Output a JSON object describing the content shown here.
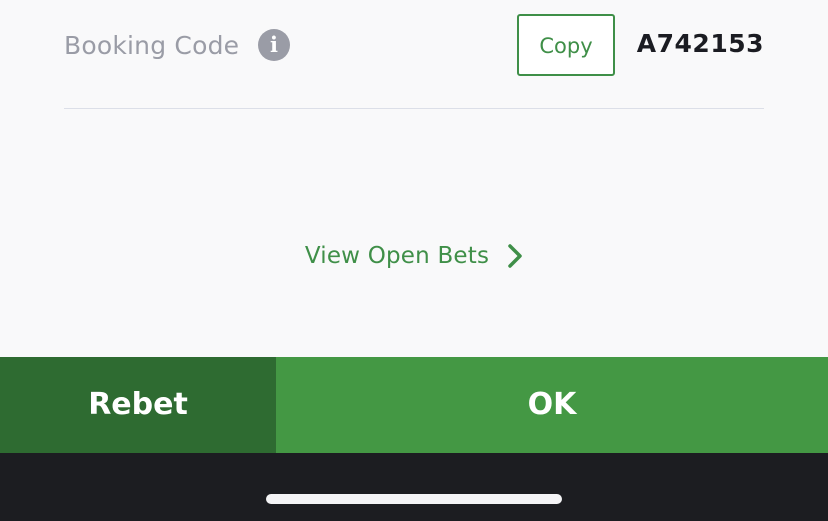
{
  "booking": {
    "label": "Booking Code",
    "info_icon": "info-icon",
    "copy_label": "Copy",
    "code": "A742153"
  },
  "open_bets": {
    "label": "View Open Bets",
    "icon": "chevron-right-icon"
  },
  "actions": {
    "rebet_label": "Rebet",
    "ok_label": "OK"
  },
  "colors": {
    "accent_green": "#3f8f48",
    "rebet_bg": "#2e6b31",
    "ok_bg": "#449844",
    "label_gray": "#9a9ca6",
    "bottom_bar": "#1c1d21"
  }
}
